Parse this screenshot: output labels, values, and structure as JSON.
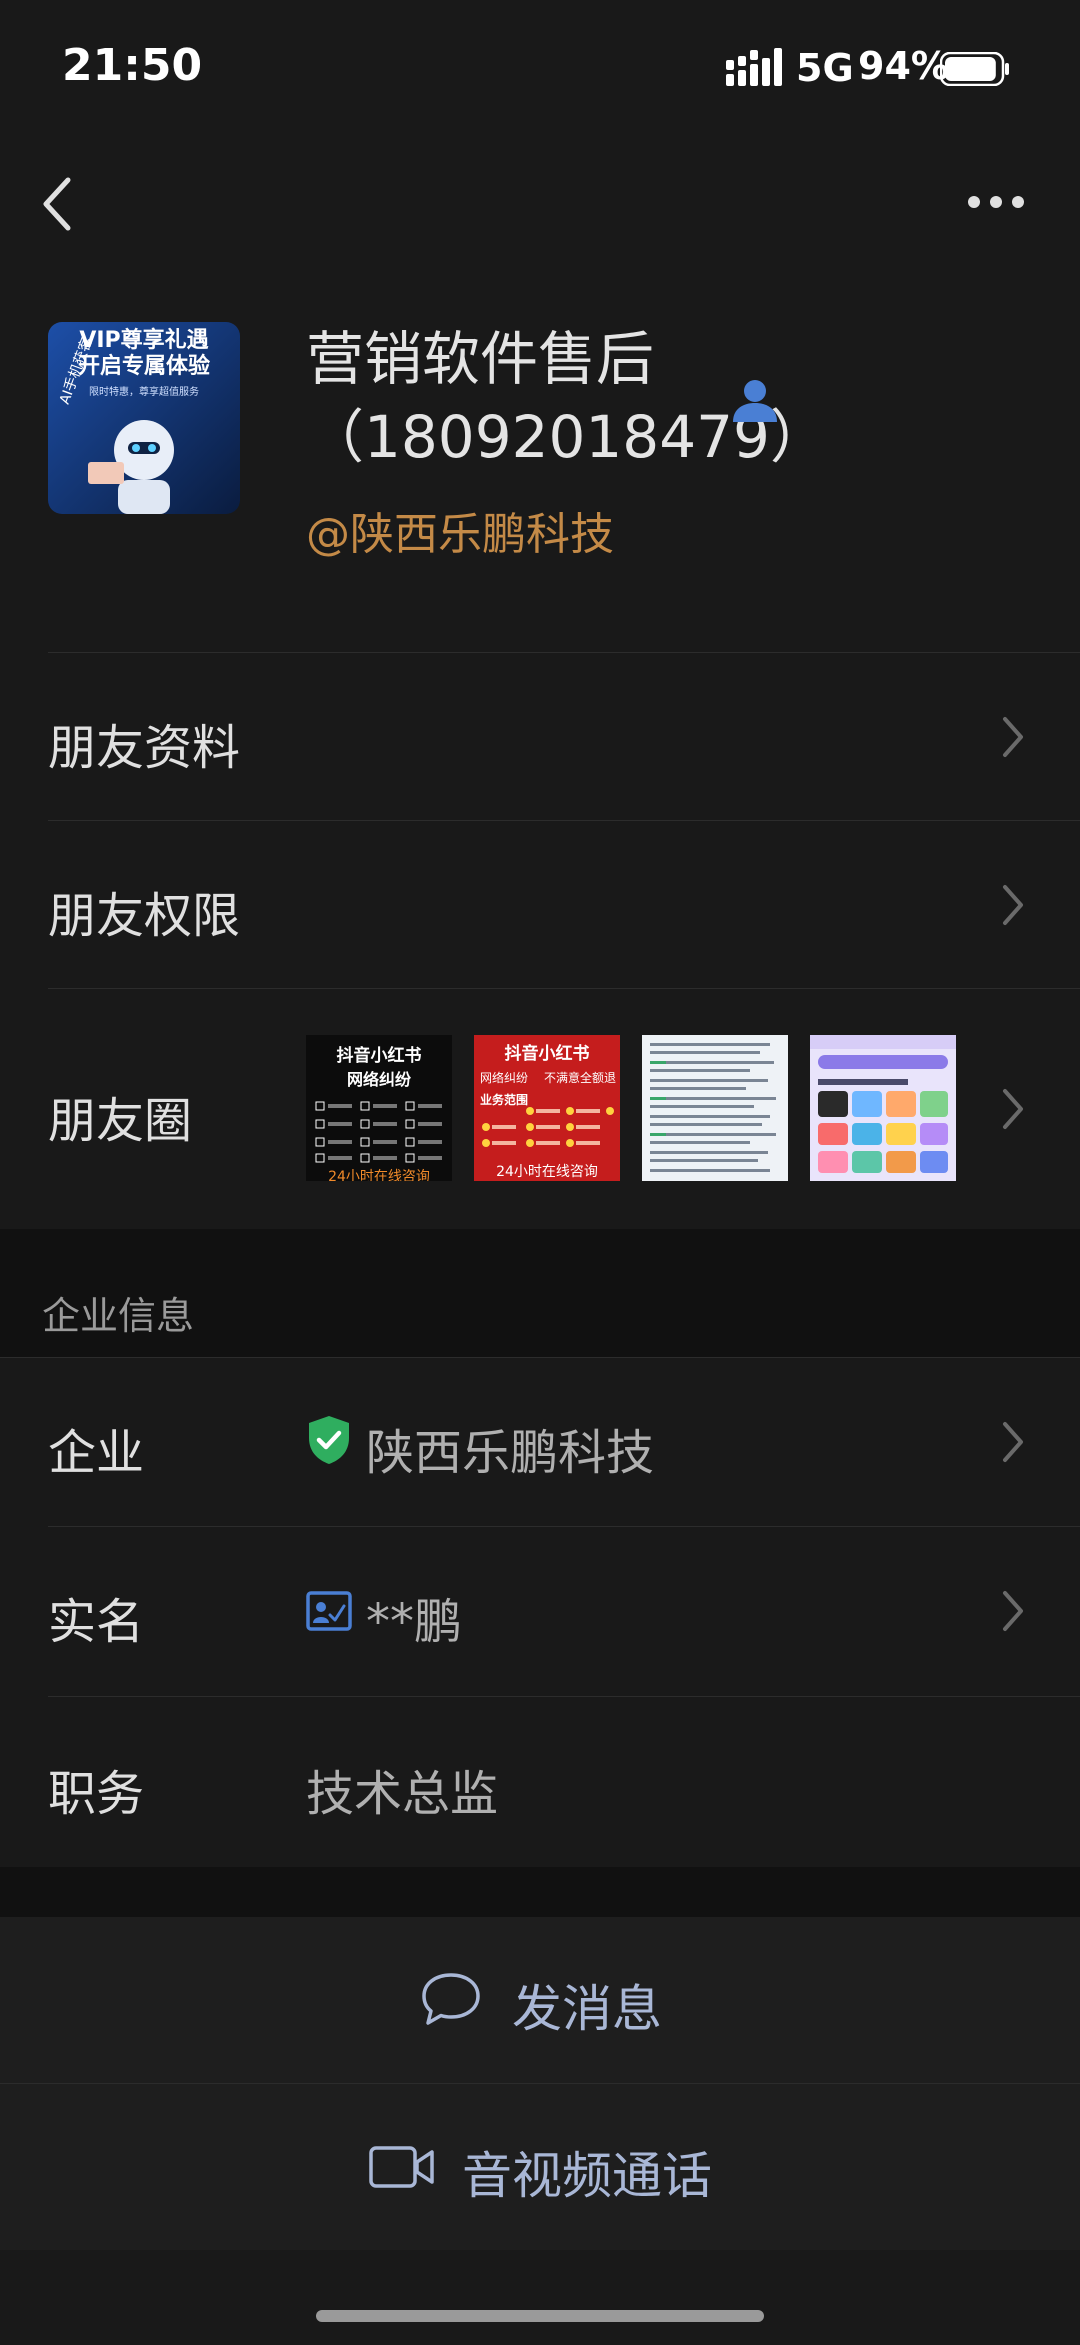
{
  "status": {
    "time": "21:50",
    "network": "5G",
    "battery": "94%",
    "battery_level": 0.94
  },
  "nav": {
    "back_icon": "chevron-left-icon",
    "more_icon": "more-dots-icon"
  },
  "profile": {
    "avatar_lines": [
      "VIP尊享礼遇",
      "开启专属体验"
    ],
    "avatar_sub": "限时特惠，尊享超值服务",
    "avatar_badge": "AI手机获客",
    "name_line1": "营销软件售后",
    "name_line2": "（18092018479）",
    "company_link": "@陕西乐鹏科技",
    "colors": {
      "company": "#c48a47",
      "person_icon": "#4a7fd4"
    }
  },
  "menu": {
    "friend_info": "朋友资料",
    "friend_permission": "朋友权限",
    "moments": "朋友圈"
  },
  "moments_thumbs": [
    {
      "title": "抖音小红书",
      "subtitle": "网络纠纷",
      "footer": "24小时在线咨询"
    },
    {
      "title": "抖音小红书",
      "subtitle": "网络纠纷",
      "tag": "不满意全额退",
      "label": "业务范围",
      "footer": "24小时在线咨询"
    },
    {
      "title": ""
    },
    {
      "title": ""
    }
  ],
  "enterprise": {
    "section_title": "企业信息",
    "company_label": "企业",
    "company_value": "陕西乐鹏科技",
    "realname_label": "实名",
    "realname_value": "**鹏",
    "position_label": "职务",
    "position_value": "技术总监",
    "colors": {
      "shield": "#2fae5f",
      "idcard": "#4a7fd4"
    }
  },
  "actions": {
    "message": "发消息",
    "call": "音视频通话",
    "color": "#a9b7d6"
  }
}
